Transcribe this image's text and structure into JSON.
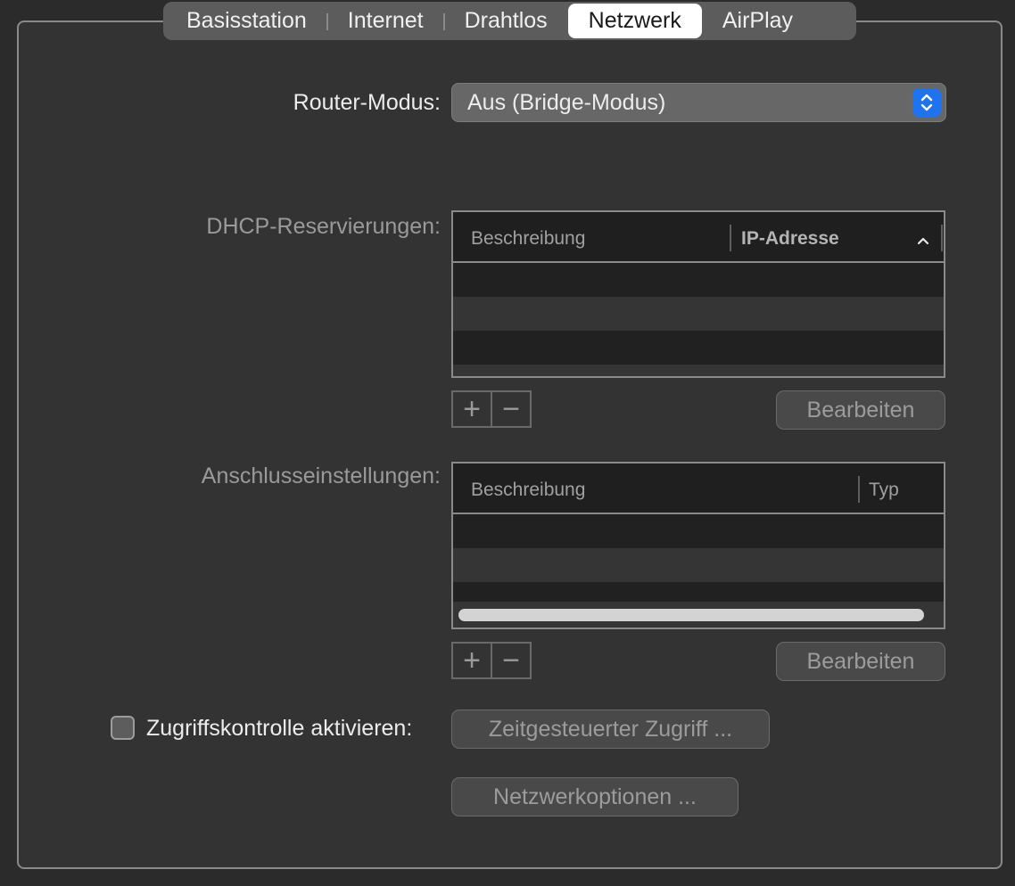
{
  "tabs": [
    {
      "label": "Basisstation",
      "active": false
    },
    {
      "label": "Internet",
      "active": false
    },
    {
      "label": "Drahtlos",
      "active": false
    },
    {
      "label": "Netzwerk",
      "active": true
    },
    {
      "label": "AirPlay",
      "active": false
    }
  ],
  "router_mode": {
    "label": "Router-Modus:",
    "value": "Aus (Bridge-Modus)",
    "icon": "chevron-up-down-icon"
  },
  "dhcp": {
    "label": "DHCP-Reservierungen:",
    "columns": [
      "Beschreibung",
      "IP-Adresse"
    ],
    "sort_icon": "chevron-up-icon",
    "add_symbol": "+",
    "remove_symbol": "−",
    "edit_label": "Bearbeiten"
  },
  "ports": {
    "label": "Anschlusseinstellungen:",
    "columns": [
      "Beschreibung",
      "Typ"
    ],
    "add_symbol": "+",
    "remove_symbol": "−",
    "edit_label": "Bearbeiten"
  },
  "access_control": {
    "label": "Zugriffskontrolle aktivieren:",
    "checked": false,
    "timed_button": "Zeitgesteuerter Zugriff ..."
  },
  "network_options_button": "Netzwerkoptionen ...",
  "colors": {
    "accent": "#1e74f0",
    "background": "#333333"
  }
}
